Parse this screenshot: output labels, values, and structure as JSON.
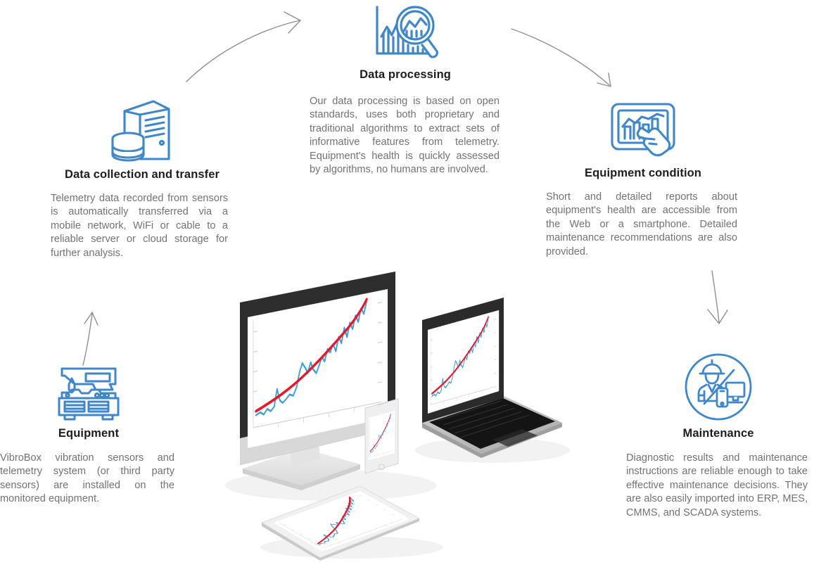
{
  "diagram": {
    "title": "Predictive maintenance process flow",
    "accent_color": "#3f87c9",
    "heading_color": "#1d1d1d",
    "body_color": "#6f7375",
    "arrow_color": "#8a8a8a",
    "background": "#ffffff"
  },
  "steps": [
    {
      "id": "data-collection-and-transfer",
      "icon": "server-database-icon",
      "heading": "Data collection and transfer",
      "body": "Telemetry data recorded from sensors is automatically transferred via a mobile network, WiFi or cable to a reliable server or cloud storage for further analysis."
    },
    {
      "id": "data-processing",
      "icon": "bar-chart-magnifier-icon",
      "heading": "Data processing",
      "body": "Our data processing is based on open standards, uses both proprietary and traditional algorithms to extract sets of informative features from telemetry. Equipment's health is quickly assessed by algorithms, no humans are involved."
    },
    {
      "id": "equipment-condition",
      "icon": "touchscreen-chart-hand-icon",
      "heading": "Equipment condition",
      "body": "Short and detailed reports about equipment's health are accessible from the Web or a smartphone. Detailed maintenance recommendations are also provided."
    },
    {
      "id": "equipment",
      "icon": "industrial-machine-icon",
      "heading": "Equipment",
      "body": "VibroBox vibration sensors and telemetry system (or third party sensors) are installed on the monitored equipment."
    },
    {
      "id": "maintenance",
      "icon": "worker-devices-circle-icon",
      "heading": "Maintenance",
      "body": "Diagnostic results and maintenance instructions are reliable enough to take effective maintenance decisions. They are also easily imported into ERP, MES, CMMS, and SCADA systems."
    }
  ],
  "arrows": [
    {
      "id": "arrow-equipment-to-collection",
      "direction": "up",
      "from": "equipment",
      "to": "data-collection-and-transfer"
    },
    {
      "id": "arrow-collection-to-processing",
      "direction": "up-right",
      "from": "data-collection-and-transfer",
      "to": "data-processing"
    },
    {
      "id": "arrow-processing-to-condition",
      "direction": "down-right",
      "from": "data-processing",
      "to": "equipment-condition"
    },
    {
      "id": "arrow-condition-to-maintenance",
      "direction": "down",
      "from": "equipment-condition",
      "to": "maintenance"
    }
  ],
  "illustration": {
    "id": "devices-mockup",
    "description": "Isometric desktop monitor, laptop, smartphone and tablet each showing a telemetry chart",
    "devices": [
      "desktop-monitor",
      "laptop",
      "smartphone",
      "tablet"
    ],
    "chart_data": {
      "type": "line",
      "title": "",
      "xlabel": "",
      "ylabel": "",
      "grid": false,
      "legend": "none",
      "series": [
        {
          "name": "trend",
          "color": "#e8172b",
          "values": [
            8,
            11,
            14,
            17,
            21,
            25,
            29,
            33,
            37,
            42,
            47,
            52,
            58,
            65,
            73,
            82,
            93,
            100
          ]
        },
        {
          "name": "telemetry",
          "color": "#3d9fd6",
          "values": [
            3,
            5,
            4,
            6,
            20,
            10,
            8,
            14,
            12,
            26,
            24,
            45,
            38,
            34,
            46,
            40,
            62,
            58,
            70,
            96
          ]
        }
      ],
      "ylim": [
        0,
        100
      ],
      "xlim": [
        0,
        100
      ]
    }
  }
}
